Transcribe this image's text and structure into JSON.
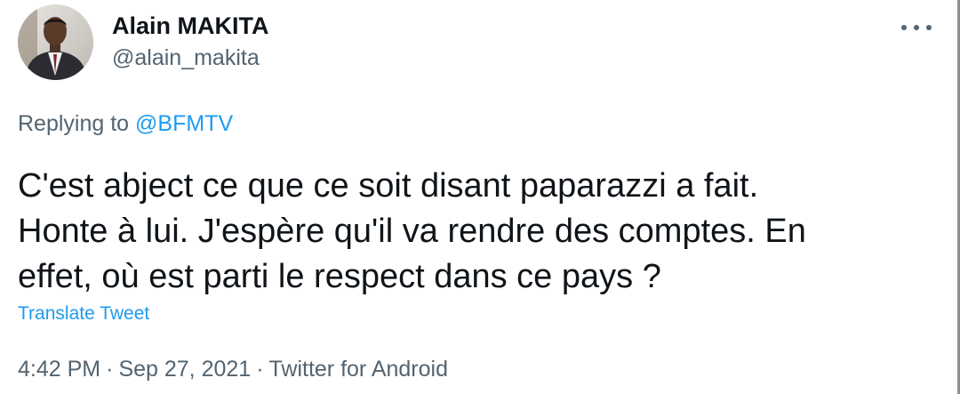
{
  "author": {
    "display_name": "Alain MAKITA",
    "handle": "@alain_makita"
  },
  "reply": {
    "prefix": "Replying to ",
    "mention": "@BFMTV"
  },
  "tweet": {
    "lines": [
      "C'est abject ce que ce soit disant paparazzi a fait.",
      "Honte à lui. J'espère qu'il va rendre des comptes. En",
      "effet, où est parti le respect dans ce pays ?"
    ],
    "translate_label": "Translate Tweet"
  },
  "meta": {
    "time": "4:42 PM",
    "separator": "·",
    "date": "Sep 27, 2021",
    "source": "Twitter for Android"
  },
  "icons": {
    "more": "more-horizontal-icon",
    "avatar": "profile-photo"
  },
  "colors": {
    "text": "#0f1419",
    "secondary": "#536471",
    "link": "#1d9bf0"
  }
}
